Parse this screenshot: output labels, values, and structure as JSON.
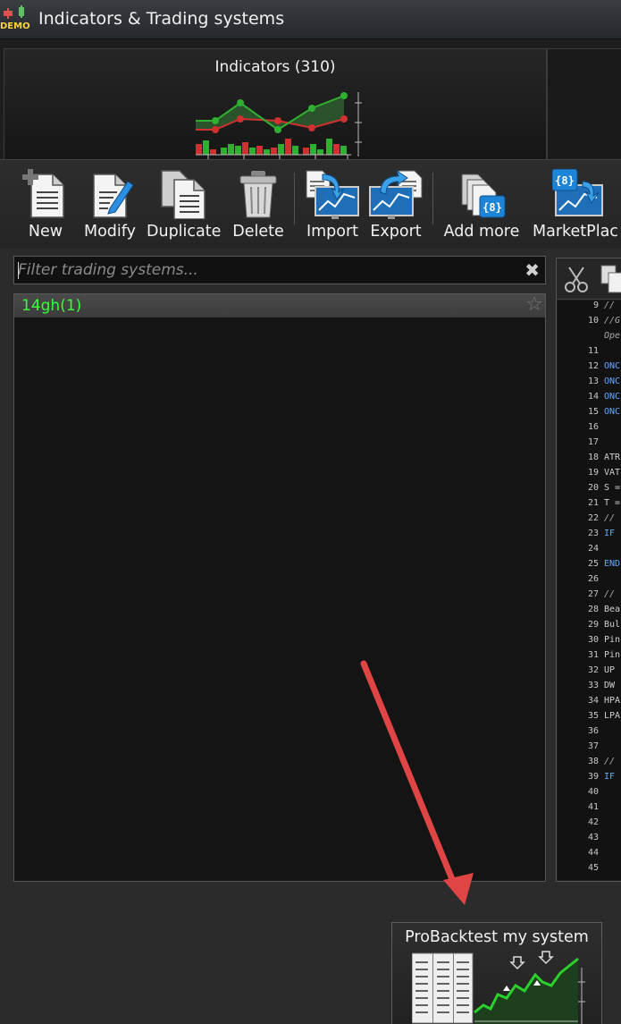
{
  "window": {
    "title": "Indicators & Trading systems",
    "badge": "DEMO"
  },
  "tabs": {
    "indicators_label": "Indicators (310)"
  },
  "toolbar": {
    "new": "New",
    "modify": "Modify",
    "duplicate": "Duplicate",
    "delete": "Delete",
    "import": "Import",
    "export": "Export",
    "add_more": "Add more",
    "marketplace": "MarketPlac"
  },
  "filter": {
    "placeholder": "Filter trading systems...",
    "value": ""
  },
  "list": {
    "items": [
      {
        "name": "14gh(1)"
      }
    ]
  },
  "code": {
    "lines": [
      {
        "n": "9",
        "t": "//",
        "style": "ital"
      },
      {
        "n": "10",
        "t": "//G",
        "style": "ital"
      },
      {
        "n": "",
        "t": "Ope",
        "style": "ital"
      },
      {
        "n": "11",
        "t": "",
        "style": ""
      },
      {
        "n": "12",
        "t": "ONC",
        "style": "blue"
      },
      {
        "n": "13",
        "t": "ONC",
        "style": "blue"
      },
      {
        "n": "14",
        "t": "ONC",
        "style": "blue"
      },
      {
        "n": "15",
        "t": "ONC",
        "style": "blue"
      },
      {
        "n": "16",
        "t": "",
        "style": ""
      },
      {
        "n": "17",
        "t": "",
        "style": ""
      },
      {
        "n": "18",
        "t": "ATR",
        "style": ""
      },
      {
        "n": "19",
        "t": "VAT",
        "style": ""
      },
      {
        "n": "20",
        "t": "S =",
        "style": ""
      },
      {
        "n": "21",
        "t": "T =",
        "style": ""
      },
      {
        "n": "22",
        "t": "//",
        "style": "ital"
      },
      {
        "n": "23",
        "t": "IF",
        "style": "blue"
      },
      {
        "n": "24",
        "t": "",
        "style": ""
      },
      {
        "n": "25",
        "t": "END",
        "style": "blue"
      },
      {
        "n": "26",
        "t": "",
        "style": ""
      },
      {
        "n": "27",
        "t": "//",
        "style": "ital"
      },
      {
        "n": "28",
        "t": "Bea",
        "style": ""
      },
      {
        "n": "29",
        "t": "Bul",
        "style": ""
      },
      {
        "n": "30",
        "t": "Pin",
        "style": ""
      },
      {
        "n": "31",
        "t": "Pin",
        "style": ""
      },
      {
        "n": "32",
        "t": "UP",
        "style": ""
      },
      {
        "n": "33",
        "t": "DW",
        "style": ""
      },
      {
        "n": "34",
        "t": "HPA",
        "style": ""
      },
      {
        "n": "35",
        "t": "LPA",
        "style": ""
      },
      {
        "n": "36",
        "t": "",
        "style": ""
      },
      {
        "n": "37",
        "t": "",
        "style": ""
      },
      {
        "n": "38",
        "t": "//",
        "style": "ital"
      },
      {
        "n": "39",
        "t": "IF",
        "style": "blue"
      },
      {
        "n": "40",
        "t": "",
        "style": ""
      },
      {
        "n": "41",
        "t": "",
        "style": ""
      },
      {
        "n": "42",
        "t": "",
        "style": ""
      },
      {
        "n": "43",
        "t": "",
        "style": ""
      },
      {
        "n": "44",
        "t": "",
        "style": ""
      },
      {
        "n": "45",
        "t": "",
        "style": ""
      }
    ]
  },
  "probacktest": {
    "label": "ProBacktest my system"
  },
  "colors": {
    "accent_green": "#39ff39",
    "annotation_arrow": "#e04040",
    "code_keyword": "#6aa6ff"
  },
  "icons": {
    "new": "new-document-icon",
    "modify": "edit-document-icon",
    "duplicate": "duplicate-icon",
    "delete": "trash-icon",
    "import": "import-icon",
    "export": "export-icon",
    "add_more": "add-more-icon",
    "marketplace": "marketplace-icon",
    "clear": "clear-x-icon",
    "favorite": "star-icon",
    "cut": "scissors-icon",
    "copy": "copy-icon"
  }
}
